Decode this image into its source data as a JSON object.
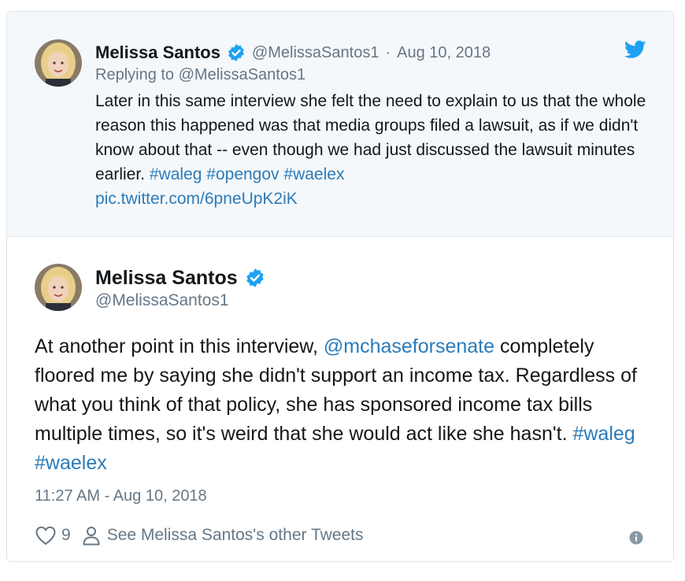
{
  "parent_tweet": {
    "author_name": "Melissa Santos",
    "author_handle": "@MelissaSantos1",
    "separator": "·",
    "date": "Aug 10, 2018",
    "reply_context": "Replying to @MelissaSantos1",
    "text_main": "Later in this same interview she felt the need to explain to us that the whole reason this happened was that media groups filed a lawsuit, as if we didn't know about that -- even though we had just discussed the lawsuit minutes earlier. ",
    "hashtags": [
      "#waleg",
      "#opengov",
      "#waelex"
    ],
    "pic_link": "pic.twitter.com/6pneUpK2iK"
  },
  "main_tweet": {
    "author_name": "Melissa Santos",
    "author_handle": "@MelissaSantos1",
    "text_before_mention": "At another point in this interview, ",
    "mention": "@mchaseforsenate",
    "text_after_mention": " completely floored me by saying she didn't support an income tax. Regardless of what you think of that policy, she has sponsored income tax bills multiple times, so it's weird that she would act like she hasn't. ",
    "hashtags": [
      "#waleg",
      "#waelex"
    ],
    "timestamp": "11:27 AM - Aug 10, 2018",
    "like_count": "9",
    "see_other_tweets": "See Melissa Santos's other Tweets"
  },
  "icons": {
    "logo": "twitter-bird-icon",
    "verified": "verified-badge-icon",
    "like": "heart-icon",
    "profile": "person-icon",
    "info": "info-icon"
  },
  "colors": {
    "link": "#2b7bb9",
    "verified": "#1da1f2",
    "twitter_blue": "#1da1f2",
    "muted": "#657786",
    "text": "#14171a",
    "parent_bg": "#f5f8fa"
  }
}
